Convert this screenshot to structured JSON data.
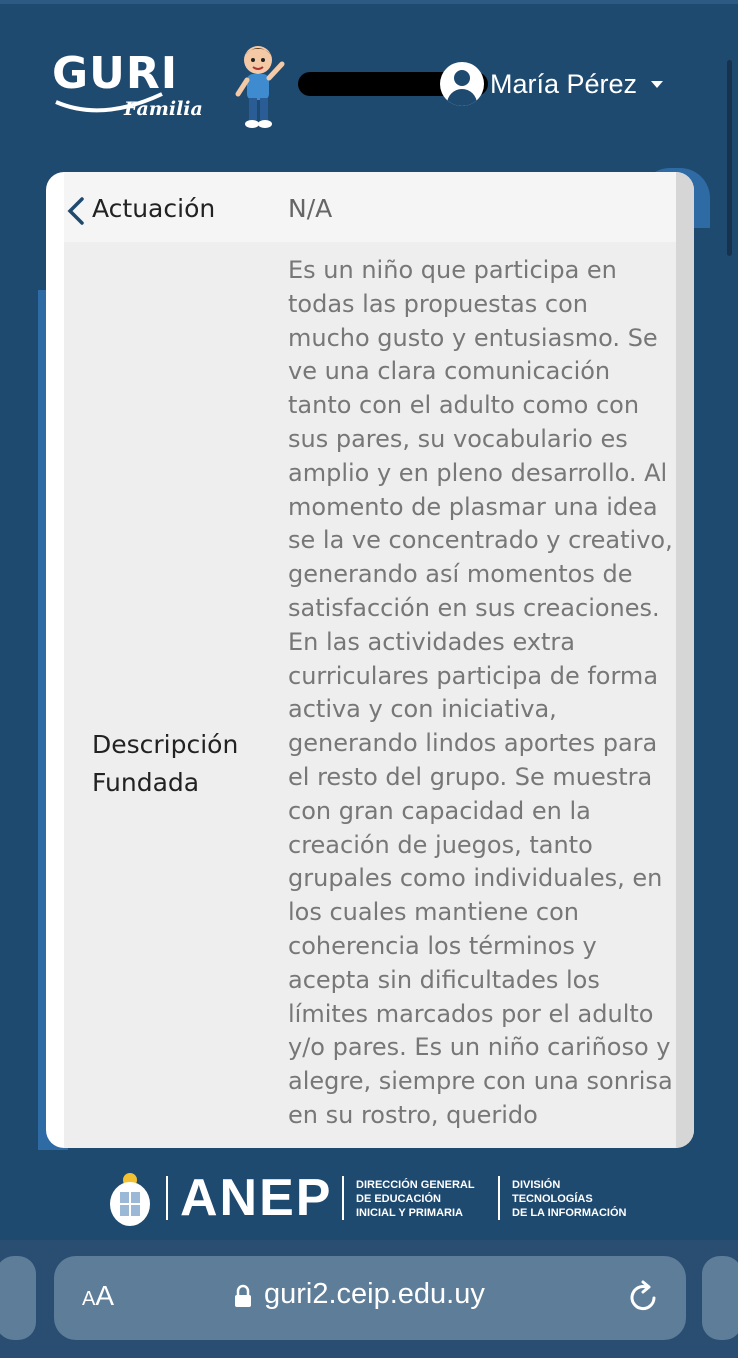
{
  "header": {
    "logo_main": "GURI",
    "logo_sub": "Familia",
    "user_name": "María Pérez"
  },
  "record": {
    "actuacion_label": "Actuación",
    "actuacion_value": "N/A",
    "descripcion_label": "Descripción Fundada",
    "descripcion_text": "Es un niño que participa en todas las propuestas con mucho gusto y entusiasmo. Se ve una clara comunicación tanto con el adulto como con sus pares, su vocabulario es amplio y en pleno desarrollo. Al momento de plasmar una idea se la ve concentrado y creativo, generando así momentos de satisfacción en sus creaciones. En las actividades extra curriculares participa de forma activa y con iniciativa, generando lindos aportes para el resto del grupo. Se muestra con gran capacidad en la creación de juegos, tanto grupales como individuales, en los cuales mantiene con coherencia los términos y acepta sin dificultades los límites marcados por el adulto y/o pares. Es un niño cariñoso y alegre, siempre con una sonrisa en su rostro, querido"
  },
  "footer": {
    "anep": "ANEP",
    "dgeip": "DIRECCIÓN GENERAL\nDE EDUCACIÓN\nINICIAL Y PRIMARIA",
    "dti": "DIVISIÓN\nTECNOLOGÍAS\nDE LA INFORMACIÓN"
  },
  "browser": {
    "text_size_label": "AA",
    "url": "guri2.ceip.edu.uy"
  }
}
